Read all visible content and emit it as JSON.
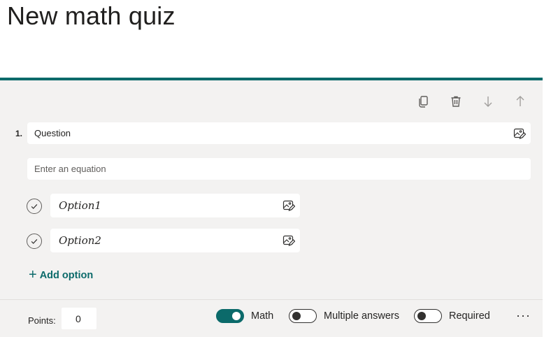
{
  "page": {
    "title": "New math quiz"
  },
  "question": {
    "number": "1.",
    "text": "Question",
    "equation_placeholder": "Enter an equation",
    "options": [
      {
        "label": "Option1",
        "icon": "check-circle-icon"
      },
      {
        "label": "Option2",
        "icon": "check-circle-icon"
      }
    ],
    "add_option_label": "Add option"
  },
  "toolbar": {
    "icons": [
      "copy-icon",
      "delete-icon",
      "move-down-icon",
      "move-up-icon"
    ]
  },
  "footer": {
    "points_label": "Points:",
    "points_value": "0",
    "math_label": "Math",
    "math_on": true,
    "multiple_answers_label": "Multiple answers",
    "multiple_answers_on": false,
    "required_label": "Required",
    "required_on": false,
    "more_label": "···"
  },
  "colors": {
    "accent": "#0b6a6a",
    "card_bg": "#f3f2f1"
  }
}
